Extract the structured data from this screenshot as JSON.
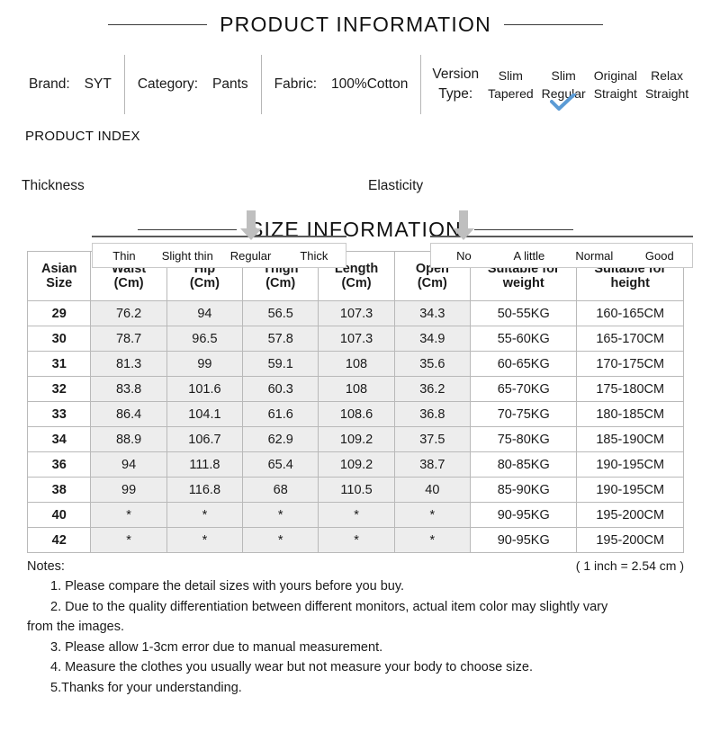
{
  "product_information": {
    "heading": "PRODUCT INFORMATION",
    "specs": [
      {
        "label": "Brand:",
        "value": "SYT"
      },
      {
        "label": "Category:",
        "value": "Pants"
      },
      {
        "label": "Fabric:",
        "value": "100%Cotton"
      }
    ],
    "version_type": {
      "label_line1": "Version",
      "label_line2": "Type:",
      "options": [
        {
          "line1": "Slim",
          "line2": "Tapered",
          "selected": false
        },
        {
          "line1": "Slim",
          "line2": "Regular",
          "selected": true
        },
        {
          "line1": "Original",
          "line2": "Straight",
          "selected": false
        },
        {
          "line1": "Relax",
          "line2": "Straight",
          "selected": false
        }
      ],
      "check_color": "#5B9BD5"
    }
  },
  "product_index": {
    "label": "PRODUCT INDEX",
    "arrow_color": "#BFBFBF",
    "indexes": [
      {
        "title": "Thickness",
        "options": [
          "Thin",
          "Slight thin",
          "Regular",
          "Thick"
        ],
        "selected_index": 2
      },
      {
        "title": "Elasticity",
        "options": [
          "No",
          "A little",
          "Normal",
          "Good"
        ],
        "selected_index": 0
      }
    ]
  },
  "size_information": {
    "heading": "SIZE INFORMATION",
    "columns": [
      {
        "line1": "Asian",
        "line2": "Size",
        "kind": "size"
      },
      {
        "line1": "Waist",
        "line2": "(Cm)",
        "kind": "measure"
      },
      {
        "line1": "Hip",
        "line2": "(Cm)",
        "kind": "measure"
      },
      {
        "line1": "Thigh",
        "line2": "(Cm)",
        "kind": "measure"
      },
      {
        "line1": "Length",
        "line2": "(Cm)",
        "kind": "measure"
      },
      {
        "line1": "Open",
        "line2": "(Cm)",
        "kind": "measure"
      },
      {
        "line1": "Suitable for",
        "line2": "weight",
        "kind": "fit"
      },
      {
        "line1": "Suitable for",
        "line2": "height",
        "kind": "fit"
      }
    ],
    "rows": [
      [
        "29",
        "76.2",
        "94",
        "56.5",
        "107.3",
        "34.3",
        "50-55KG",
        "160-165CM"
      ],
      [
        "30",
        "78.7",
        "96.5",
        "57.8",
        "107.3",
        "34.9",
        "55-60KG",
        "165-170CM"
      ],
      [
        "31",
        "81.3",
        "99",
        "59.1",
        "108",
        "35.6",
        "60-65KG",
        "170-175CM"
      ],
      [
        "32",
        "83.8",
        "101.6",
        "60.3",
        "108",
        "36.2",
        "65-70KG",
        "175-180CM"
      ],
      [
        "33",
        "86.4",
        "104.1",
        "61.6",
        "108.6",
        "36.8",
        "70-75KG",
        "180-185CM"
      ],
      [
        "34",
        "88.9",
        "106.7",
        "62.9",
        "109.2",
        "37.5",
        "75-80KG",
        "185-190CM"
      ],
      [
        "36",
        "94",
        "111.8",
        "65.4",
        "109.2",
        "38.7",
        "80-85KG",
        "190-195CM"
      ],
      [
        "38",
        "99",
        "116.8",
        "68",
        "110.5",
        "40",
        "85-90KG",
        "190-195CM"
      ],
      [
        "40",
        "*",
        "*",
        "*",
        "*",
        "*",
        "90-95KG",
        "195-200CM"
      ],
      [
        "42",
        "*",
        "*",
        "*",
        "*",
        "*",
        "90-95KG",
        "195-200CM"
      ]
    ]
  },
  "notes": {
    "title": "Notes:",
    "inch_conversion": "( 1 inch = 2.54 cm )",
    "lines": [
      "1. Please compare the detail sizes with yours before you buy.",
      "2. Due to the quality differentiation between different monitors, actual item color may slightly vary",
      "from the images.",
      "3. Please allow 1-3cm error due to manual measurement.",
      "4. Measure the clothes you usually wear but not measure your body to choose size.",
      "5.Thanks for your understanding."
    ]
  }
}
